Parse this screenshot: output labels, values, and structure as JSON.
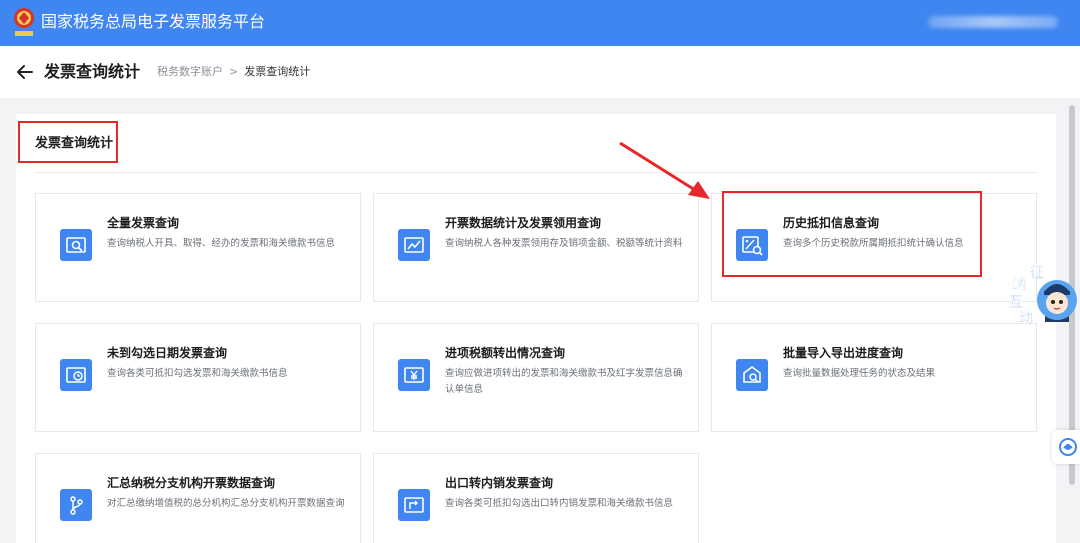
{
  "app": {
    "title": "国家税务总局电子发票服务平台",
    "logo_icon": "tax-emblem-icon"
  },
  "header": {
    "back_icon": "arrow-left-icon",
    "page_title": "发票查询统计",
    "breadcrumb": [
      "税务数字账户",
      "发票查询统计"
    ],
    "breadcrumb_separator": ">"
  },
  "section": {
    "title": "发票查询统计"
  },
  "cards": [
    {
      "title": "全量发票查询",
      "desc": "查询纳税人开具、取得、经办的发票和海关缴款书信息",
      "icon": "invoice-search-icon"
    },
    {
      "title": "开票数据统计及发票领用查询",
      "desc": "查询纳税人各种发票领用存及销项金额、税额等统计资料",
      "icon": "invoice-chart-icon"
    },
    {
      "title": "历史抵扣信息查询",
      "desc": "查询多个历史税款所属期抵扣统计确认信息",
      "icon": "percent-search-icon"
    },
    {
      "title": "未到勾选日期发票查询",
      "desc": "查询各类可抵扣勾选发票和海关缴款书信息",
      "icon": "invoice-clock-icon"
    },
    {
      "title": "进项税额转出情况查询",
      "desc": "查询应做进项转出的发票和海关缴款书及红字发票信息确认单信息",
      "icon": "yen-transfer-icon"
    },
    {
      "title": "批量导入导出进度查询",
      "desc": "查询批量数据处理任务的状态及结果",
      "icon": "import-export-search-icon"
    },
    {
      "title": "汇总纳税分支机构开票数据查询",
      "desc": "对汇总缴纳增值税的总分机构汇总分支机构开票数据查询",
      "icon": "branch-icon"
    },
    {
      "title": "出口转内销发票查询",
      "desc": "查询各类可抵扣勾选出口转内销发票和海关缴款书信息",
      "icon": "export-return-icon"
    }
  ],
  "assistant": {
    "chars": [
      "征",
      "纳",
      "互",
      "动"
    ],
    "icon": "tax-officer-avatar-icon"
  },
  "side_widget": {
    "icon": "customer-service-icon"
  },
  "colors": {
    "primary": "#3f86f0",
    "highlight": "#e5282a"
  }
}
